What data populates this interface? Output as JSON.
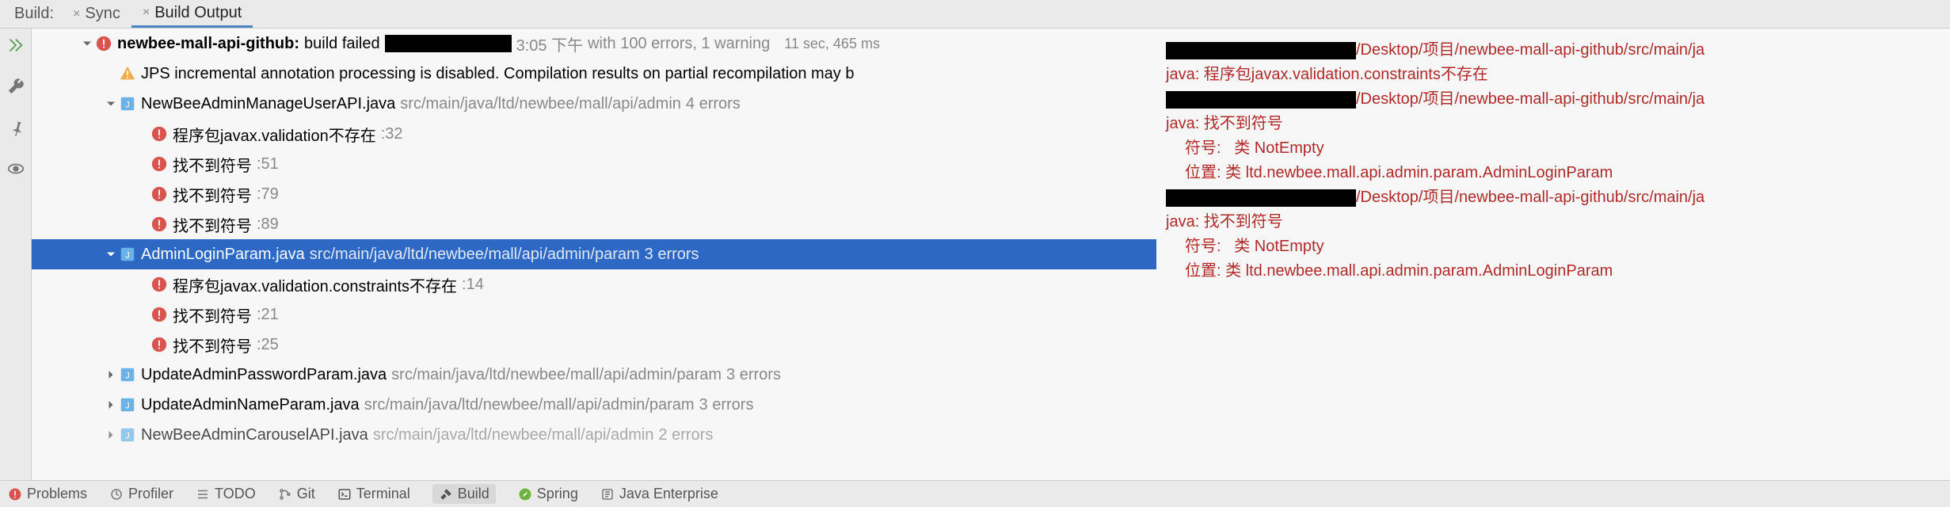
{
  "tabs": {
    "label": "Build:",
    "sync": "Sync",
    "output": "Build Output"
  },
  "tree": {
    "root": {
      "name": "newbee-mall-api-github:",
      "status": "build failed",
      "time": "3:05 下午",
      "with": "with 100 errors, 1 warning",
      "duration": "11 sec, 465 ms"
    },
    "jps": "JPS incremental annotation processing is disabled. Compilation results on partial recompilation may b",
    "file1": {
      "name": "NewBeeAdminManageUserAPI.java",
      "path": "src/main/java/ltd/newbee/mall/api/admin",
      "errs": "4 errors",
      "e1": {
        "msg": "程序包javax.validation不存在",
        "line": ":32"
      },
      "e2": {
        "msg": "找不到符号",
        "line": ":51"
      },
      "e3": {
        "msg": "找不到符号",
        "line": ":79"
      },
      "e4": {
        "msg": "找不到符号",
        "line": ":89"
      }
    },
    "file2": {
      "name": "AdminLoginParam.java",
      "path": "src/main/java/ltd/newbee/mall/api/admin/param",
      "errs": "3 errors",
      "e1": {
        "msg": "程序包javax.validation.constraints不存在",
        "line": ":14"
      },
      "e2": {
        "msg": "找不到符号",
        "line": ":21"
      },
      "e3": {
        "msg": "找不到符号",
        "line": ":25"
      }
    },
    "file3": {
      "name": "UpdateAdminPasswordParam.java",
      "path": "src/main/java/ltd/newbee/mall/api/admin/param",
      "errs": "3 errors"
    },
    "file4": {
      "name": "UpdateAdminNameParam.java",
      "path": "src/main/java/ltd/newbee/mall/api/admin/param",
      "errs": "3 errors"
    },
    "file5": {
      "name": "NewBeeAdminCarouselAPI.java",
      "path": "src/main/java/ltd/newbee/mall/api/admin",
      "errs": "2 errors"
    }
  },
  "log": {
    "path_suffix": "/Desktop/项目/newbee-mall-api-github/src/main/ja",
    "l1": "java: 程序包javax.validation.constraints不存在",
    "l2": "java: 找不到符号",
    "l3_a": "符号:",
    "l3_b": "类 NotEmpty",
    "l4_a": "位置:",
    "l4_b": "类 ltd.newbee.mall.api.admin.param.AdminLoginParam"
  },
  "bottom": {
    "problems": "Problems",
    "profiler": "Profiler",
    "todo": "TODO",
    "git": "Git",
    "terminal": "Terminal",
    "build": "Build",
    "spring": "Spring",
    "java_ee": "Java Enterprise"
  }
}
